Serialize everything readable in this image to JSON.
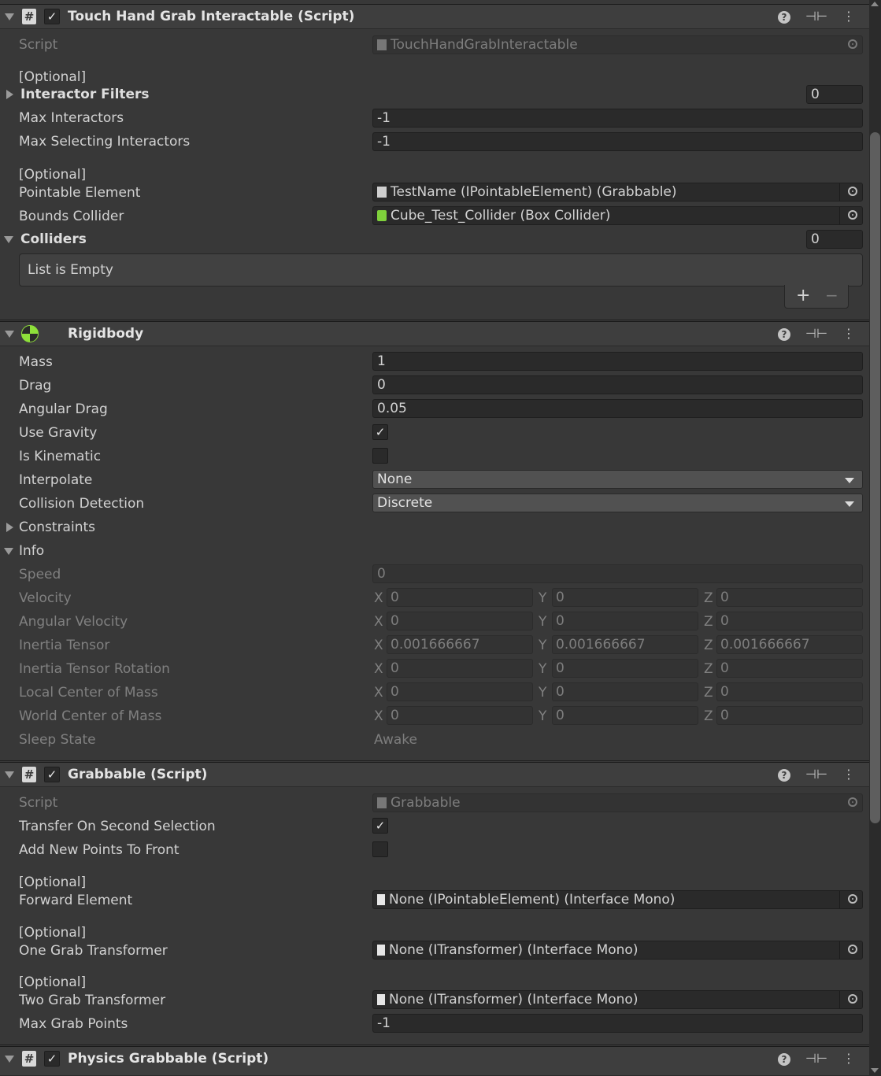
{
  "touch": {
    "title": "Touch Hand Grab Interactable (Script)",
    "script_label": "Script",
    "script_value": "TouchHandGrabInteractable",
    "optional1": "[Optional]",
    "interactor_filters": "Interactor Filters",
    "interactor_filters_count": "0",
    "max_interactors_label": "Max Interactors",
    "max_interactors": "-1",
    "max_selecting_label": "Max Selecting Interactors",
    "max_selecting": "-1",
    "optional2": "[Optional]",
    "pointable_label": "Pointable Element",
    "pointable_value": "TestName (IPointableElement) (Grabbable)",
    "bounds_label": "Bounds Collider",
    "bounds_value": "Cube_Test_Collider (Box Collider)",
    "colliders_label": "Colliders",
    "colliders_count": "0",
    "list_empty": "List is Empty",
    "add": "+",
    "remove": "−"
  },
  "rigidbody": {
    "title": "Rigidbody",
    "mass_label": "Mass",
    "mass": "1",
    "drag_label": "Drag",
    "drag": "0",
    "angular_drag_label": "Angular Drag",
    "angular_drag": "0.05",
    "use_gravity_label": "Use Gravity",
    "use_gravity": "✓",
    "is_kinematic_label": "Is Kinematic",
    "is_kinematic": "",
    "interpolate_label": "Interpolate",
    "interpolate": "None",
    "collision_label": "Collision Detection",
    "collision": "Discrete",
    "constraints_label": "Constraints",
    "info_label": "Info",
    "speed_label": "Speed",
    "speed": "0",
    "sleep_label": "Sleep State",
    "sleep": "Awake",
    "axis_x": "X",
    "axis_y": "Y",
    "axis_z": "Z",
    "vectors": [
      {
        "label": "Velocity",
        "x": "0",
        "y": "0",
        "z": "0"
      },
      {
        "label": "Angular Velocity",
        "x": "0",
        "y": "0",
        "z": "0"
      },
      {
        "label": "Inertia Tensor",
        "x": "0.001666667",
        "y": "0.001666667",
        "z": "0.001666667"
      },
      {
        "label": "Inertia Tensor Rotation",
        "x": "0",
        "y": "0",
        "z": "0"
      },
      {
        "label": "Local Center of Mass",
        "x": "0",
        "y": "0",
        "z": "0"
      },
      {
        "label": "World Center of Mass",
        "x": "0",
        "y": "0",
        "z": "0"
      }
    ]
  },
  "grabbable": {
    "title": "Grabbable (Script)",
    "script_label": "Script",
    "script_value": "Grabbable",
    "transfer_label": "Transfer On Second Selection",
    "transfer": "✓",
    "add_front_label": "Add New Points To Front",
    "add_front": "",
    "optional": "[Optional]",
    "forward_label": "Forward Element",
    "forward_value": "None (IPointableElement) (Interface Mono)",
    "one_grab_label": "One Grab Transformer",
    "one_grab_value": "None (ITransformer) (Interface Mono)",
    "two_grab_label": "Two Grab Transformer",
    "two_grab_value": "None (ITransformer) (Interface Mono)",
    "max_points_label": "Max Grab Points",
    "max_points": "-1"
  },
  "physics": {
    "title": "Physics Grabbable (Script)"
  },
  "icons": {
    "enabled_check": "✓",
    "hash": "#",
    "help": "?",
    "presets": "⊣⊢",
    "menu": "⋮"
  }
}
